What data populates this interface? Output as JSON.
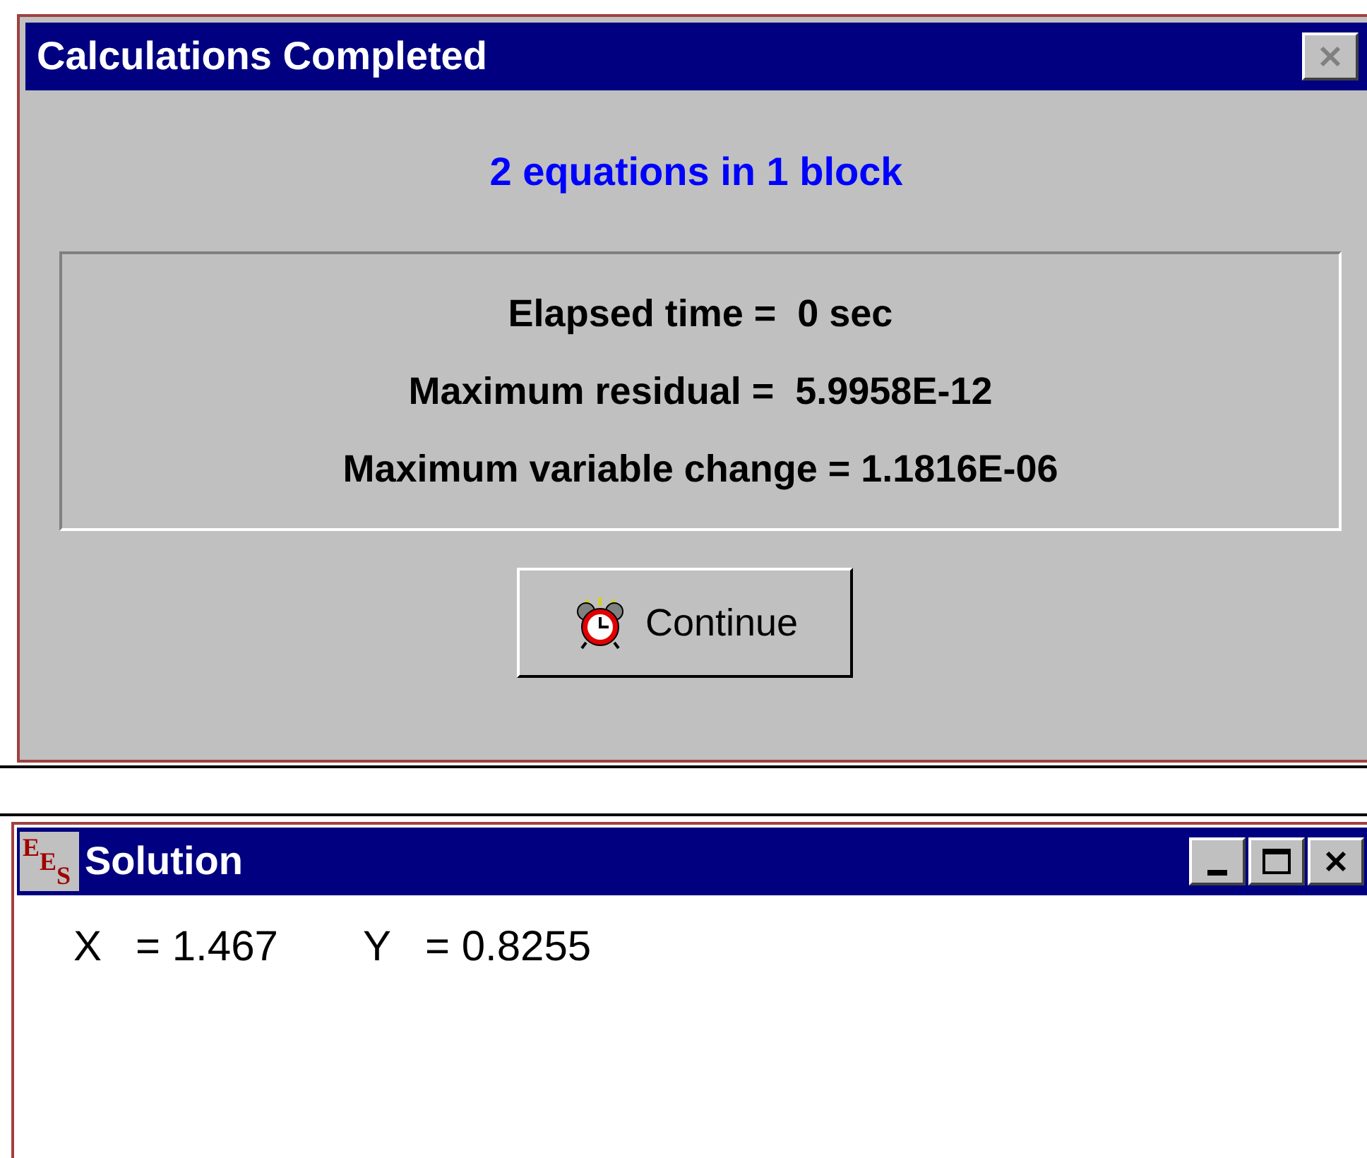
{
  "dialog": {
    "title": "Calculations Completed",
    "summary": "2 equations in 1 block",
    "stats": [
      "Elapsed time =  0 sec",
      "Maximum residual =  5.9958E-12",
      "Maximum variable change = 1.1816E-06"
    ],
    "button": "Continue"
  },
  "solution_window": {
    "app_icon_letters": [
      "E",
      "E",
      "S"
    ],
    "title": "Solution",
    "variables": [
      {
        "name": "X",
        "value": "= 1.467"
      },
      {
        "name": "Y",
        "value": "= 0.8255"
      }
    ]
  }
}
